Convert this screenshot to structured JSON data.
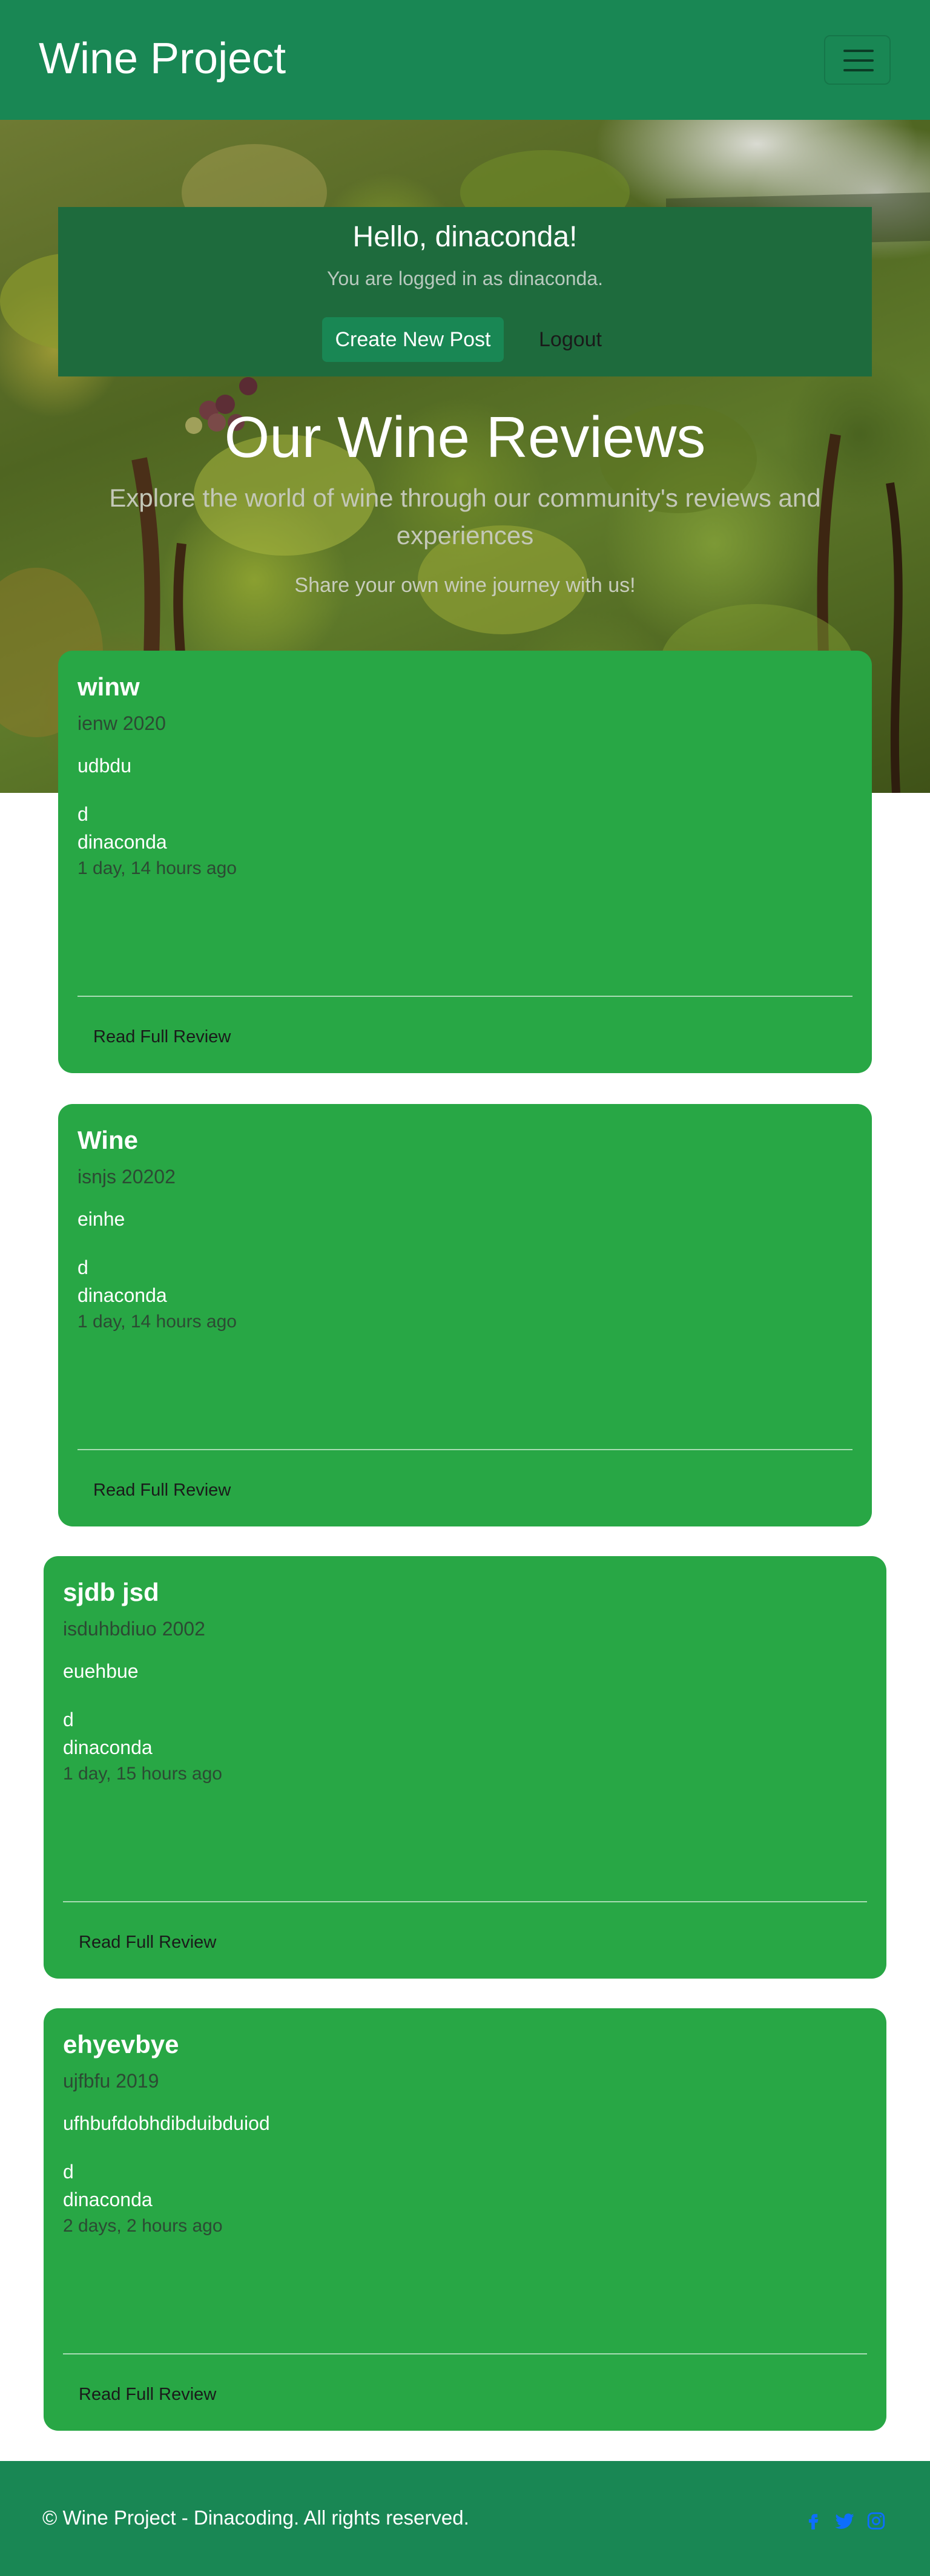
{
  "navbar": {
    "brand": "Wine Project",
    "toggler_icon": "hamburger-menu-icon"
  },
  "welcome": {
    "greeting": "Hello, dinaconda!",
    "logged_in_text": "You are logged in as dinaconda.",
    "create_label": "Create New Post",
    "logout_label": "Logout"
  },
  "hero": {
    "title": "Our Wine Reviews",
    "subtitle": "Explore the world of wine through our community's reviews and experiences",
    "cta": "Share your own wine journey with us!"
  },
  "reviews": [
    {
      "title": "winw",
      "wine": "ienw 2020",
      "body": "udbdu",
      "extra": "d",
      "author": "dinaconda",
      "time": "1 day, 14 hours ago",
      "button": "Read Full Review"
    },
    {
      "title": "Wine",
      "wine": "isnjs 20202",
      "body": "einhe",
      "extra": "d",
      "author": "dinaconda",
      "time": "1 day, 14 hours ago",
      "button": "Read Full Review"
    },
    {
      "title": "sjdb jsd",
      "wine": "isduhbdiuo 2002",
      "body": "euehbue",
      "extra": "d",
      "author": "dinaconda",
      "time": "1 day, 15 hours ago",
      "button": "Read Full Review"
    },
    {
      "title": "ehyevbye",
      "wine": "ujfbfu 2019",
      "body": "ufhbufdobhdibduibduiod",
      "extra": "d",
      "author": "dinaconda",
      "time": "2 days, 2 hours ago",
      "button": "Read Full Review"
    }
  ],
  "footer": {
    "text": "© Wine Project - Dinacoding. All rights reserved.",
    "social_icons": [
      "facebook-icon",
      "twitter-icon",
      "instagram-icon"
    ]
  },
  "colors": {
    "primary": "#198754",
    "card": "#28a745",
    "welcome_panel": "#1e6b3d",
    "social_link": "#0d6efd"
  }
}
